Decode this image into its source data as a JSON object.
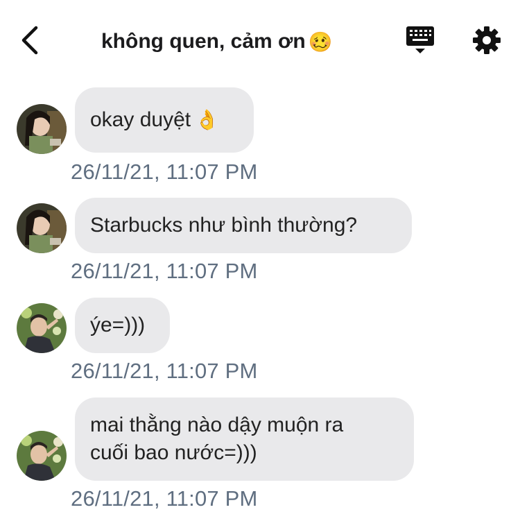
{
  "header": {
    "title": "không quen, cảm ơn",
    "title_emoji": "🥴",
    "back_icon": "chevron-left-icon",
    "keyboard_icon": "keyboard-icon",
    "settings_icon": "gear-icon"
  },
  "messages": [
    {
      "text": "okay duyệt",
      "emoji": "👌",
      "timestamp": "26/11/21, 11:07 PM",
      "sender": "girl"
    },
    {
      "text": "Starbucks như bình thường?",
      "emoji": "",
      "timestamp": "26/11/21, 11:07 PM",
      "sender": "girl"
    },
    {
      "text": "ýe=)))",
      "emoji": "",
      "timestamp": "26/11/21, 11:07 PM",
      "sender": "boy"
    },
    {
      "text_line1": "mai thằng nào dậy muộn ra",
      "text_line2": "cuối bao nước=)))",
      "timestamp": "26/11/21, 11:07 PM",
      "sender": "boy"
    }
  ],
  "colors": {
    "bubble": "#e9e9eb",
    "timestamp": "#5f6e80",
    "text": "#222222"
  }
}
